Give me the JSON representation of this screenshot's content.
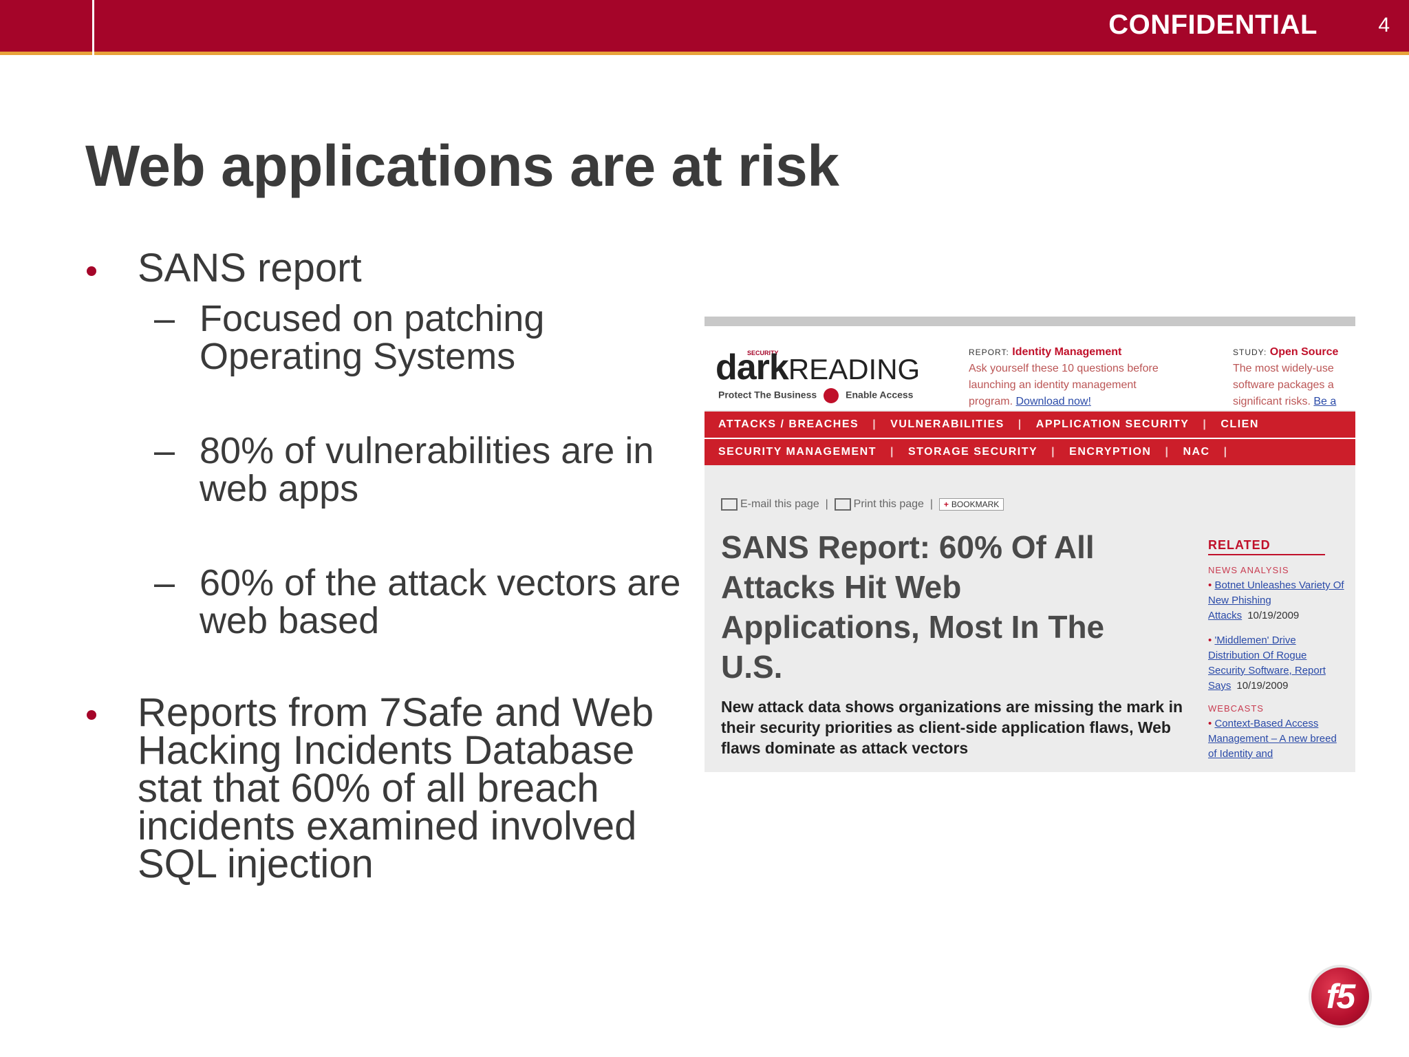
{
  "header": {
    "confidential": "CONFIDENTIAL",
    "page_number": "4"
  },
  "title": "Web applications are at risk",
  "bullets": {
    "sans": "SANS report",
    "sub1": "Focused on patching Operating Systems",
    "sub2": "80% of vulnerabilities are in web apps",
    "sub3": "60% of the attack vectors are web based",
    "reports": "Reports from 7Safe and Web Hacking Incidents Database stat that 60% of all breach incidents examined involved SQL injection",
    "dash": "–"
  },
  "screenshot": {
    "logo_small": "SECURITY",
    "logo_dark": "dark",
    "logo_reading": "READING",
    "tagline_left": "Protect The Business",
    "tagline_right": "Enable Access",
    "promo1": {
      "kind": "REPORT:",
      "topic": "Identity Management",
      "lines": [
        "Ask yourself these 10 questions before",
        "launching an identity management",
        "program."
      ],
      "link": "Download now!"
    },
    "promo2": {
      "kind": "STUDY:",
      "topic": "Open Source",
      "lines": [
        "The most widely-use",
        "software packages a",
        "significant risks."
      ],
      "link": "Be a"
    },
    "nav1": [
      "ATTACKS / BREACHES",
      "VULNERABILITIES",
      "APPLICATION SECURITY",
      "CLIEN"
    ],
    "nav2": [
      "SECURITY MANAGEMENT",
      "STORAGE SECURITY",
      "ENCRYPTION",
      "NAC"
    ],
    "tools": {
      "email": "E-mail this page",
      "print": "Print this page",
      "bookmark": "BOOKMARK"
    },
    "headline": "SANS Report: 60% Of All Attacks Hit Web Applications, Most In The U.S.",
    "lede": "New attack data shows organizations are missing the mark in their security priorities as client-side application flaws, Web flaws dominate as attack vectors",
    "related": {
      "heading": "RELATED",
      "news_label": "NEWS ANALYSIS",
      "news1": "Botnet Unleashes Variety Of New Phishing Attacks",
      "news1_date": "10/19/2009",
      "news2": "'Middlemen' Drive Distribution Of Rogue Security Software, Report Says",
      "news2_date": "10/19/2009",
      "webcasts_label": "WEBCASTS",
      "webcast1": "Context-Based Access Management – A new breed of Identity and"
    }
  },
  "logo_text": "f5",
  "colors": {
    "brand_red": "#a50529",
    "accent_orange": "#e8a23a",
    "text": "#3a3a3a"
  }
}
